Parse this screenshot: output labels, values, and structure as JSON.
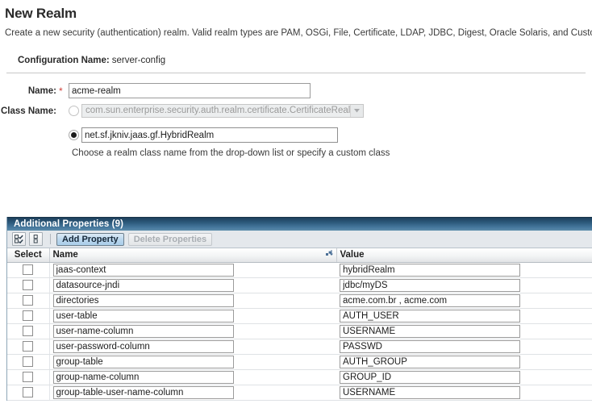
{
  "header": {
    "title": "New Realm",
    "description": "Create a new security (authentication) realm. Valid realm types are PAM, OSGi, File, Certificate, LDAP, JDBC, Digest, Oracle Solaris, and Custom."
  },
  "config": {
    "label": "Configuration Name:",
    "value": "server-config"
  },
  "form": {
    "name_label": "Name:",
    "required_marker": "*",
    "name_value": "acme-realm",
    "class_label": "Class Name:",
    "class_dropdown_selected": "com.sun.enterprise.security.auth.realm.certificate.CertificateRealm",
    "class_dropdown_icon": "chevron-down-icon",
    "custom_class_value": "net.sf.jkniv.jaas.gf.HybridRealm",
    "help_text": "Choose a realm class name from the drop-down list or specify a custom class"
  },
  "panel": {
    "title": "Additional Properties (9)",
    "toolbar": {
      "select_all_icon": "select-all-icon",
      "deselect_all_icon": "deselect-all-icon",
      "add_label": "Add Property",
      "delete_label": "Delete Properties"
    },
    "columns": {
      "select": "Select",
      "name": "Name",
      "value": "Value",
      "sort_icon": "sort-icon"
    },
    "rows": [
      {
        "name": "jaas-context",
        "value": "hybridRealm"
      },
      {
        "name": "datasource-jndi",
        "value": "jdbc/myDS"
      },
      {
        "name": "directories",
        "value": "acme.com.br , acme.com"
      },
      {
        "name": "user-table",
        "value": "AUTH_USER"
      },
      {
        "name": "user-name-column",
        "value": "USERNAME"
      },
      {
        "name": "user-password-column",
        "value": "PASSWD"
      },
      {
        "name": "group-table",
        "value": "AUTH_GROUP"
      },
      {
        "name": "group-name-column",
        "value": "GROUP_ID"
      },
      {
        "name": "group-table-user-name-column",
        "value": "USERNAME"
      }
    ]
  },
  "colors": {
    "panel_title_dark": "#1d3f5c",
    "panel_title_light": "#5c8cab",
    "required_star": "#d0403a",
    "primary_button": "#a9cde9"
  }
}
